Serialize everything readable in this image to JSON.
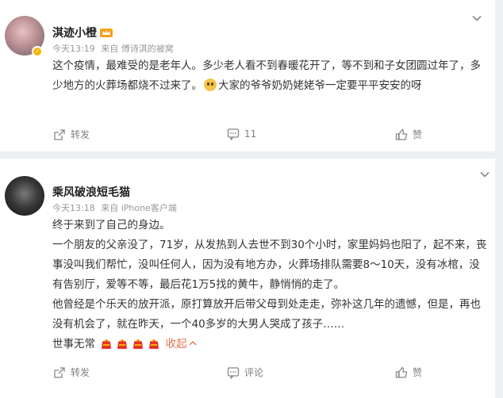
{
  "posts": [
    {
      "author": "淇迹小橙",
      "time": "今天13:19",
      "source": "来自 傅诗淇的被窝",
      "text_before_emoji": "这个疫情，最难受的是老年人。多少老人看不到春暖花开了，等不到和子女团圆过年了，多少地方的火葬场都烧不过来了。",
      "text_after_emoji": "大家的爷爷奶奶姥姥爷一定要平平安安的呀",
      "emoji_icon": "sad-face-icon",
      "actions": {
        "repost": "转发",
        "comment": "11",
        "like": "赞"
      }
    },
    {
      "author": "乘风破浪短毛猫",
      "time": "今天13:18",
      "source": "来自 iPhone客户端",
      "paragraphs": [
        "终于来到了自己的身边。",
        "一个朋友的父亲没了，71岁，从发热到人去世不到30个小时，家里妈妈也阳了，起不来，丧事没叫我们帮忙，没叫任何人，因为没有地方办，火葬场排队需要8～10天，没有冰棺，没有告别厅，爱等不等，最后花1万5找的黄牛，静悄悄的走了。",
        "他曾经是个乐天的放开派，原打算放开后带父母到处走走，弥补这几年的遗憾，但是，再也没有机会了，就在昨天，一个40多岁的大男人哭成了孩子……"
      ],
      "last_line": "世事无常",
      "emoji_icon": "candle-icon",
      "collapse_label": "收起",
      "actions": {
        "repost": "转发",
        "comment": "评论",
        "like": "赞"
      }
    }
  ],
  "colors": {
    "accent": "#eb7350",
    "muted": "#999999",
    "background": "#eef0f3"
  }
}
